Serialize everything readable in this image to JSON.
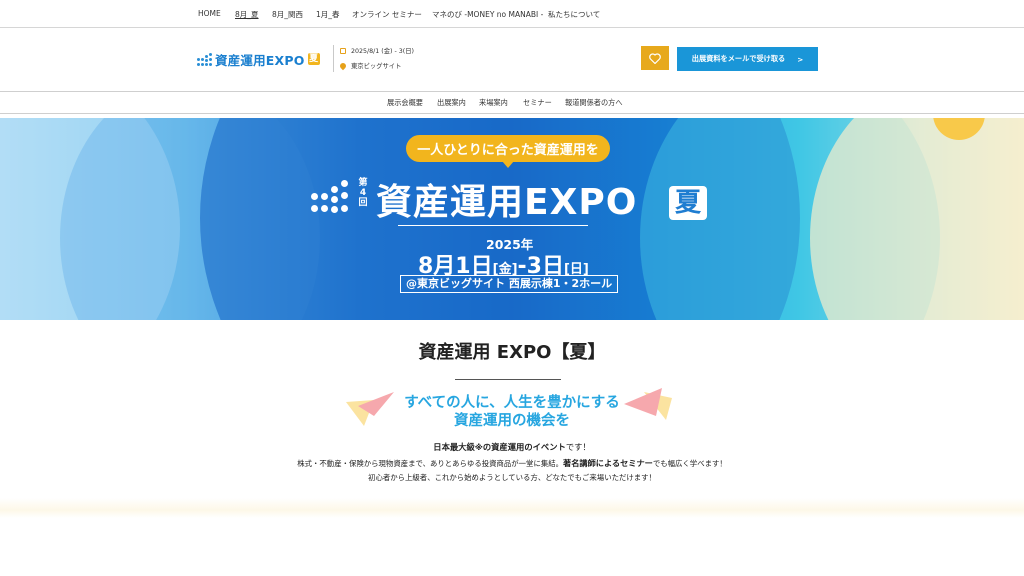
{
  "top_nav": [
    "HOME",
    "8月_夏",
    "8月_関西",
    "1月_春",
    "オンライン セミナー",
    "マネのび -MONEY no MANABI -",
    "私たちについて"
  ],
  "header": {
    "logo_text": "資産運用EXPO",
    "logo_badge": "夏",
    "date": "2025/8/1 (金) - 3(日)",
    "venue": "東京ビッグサイト",
    "favorite_icon": "heart-icon",
    "cta_label": "出展資料をメールで受け取る",
    "cta_arrow": ">"
  },
  "sub_nav": [
    "展示会概要",
    "出展案内",
    "来場案内",
    "セミナー",
    "報道関係者の方へ"
  ],
  "hero": {
    "pill": "一人ひとりに合った資産運用を",
    "edition": "第4回",
    "title": "資産運用EXPO",
    "badge": "夏",
    "year": "2025年",
    "date_main": "8月1日",
    "date_day1": "[金]",
    "date_sep": "-3日",
    "date_day2": "[日]",
    "venue": "@東京ビッグサイト 西展示棟1・2ホール"
  },
  "main": {
    "title": "資産運用 EXPO【夏】",
    "tagline_1": "すべての人に、人生を豊かにする",
    "tagline_2": "資産運用の機会を",
    "p1_strong": "日本最大級※の資産運用のイベント",
    "p1_rest": "です！",
    "p2_a": "株式・不動産・保険から現物資産まで、ありとあらゆる投資商品が一堂に集結。",
    "p2_strong": "著名講師によるセミナー",
    "p2_b": "でも幅広く学べます！",
    "p3": "初心者から上級者、これから始めようとしている方、どなたでもご来場いただけます！"
  },
  "colors": {
    "brand_blue": "#1a96d8",
    "accent_yellow": "#f2b51d",
    "tagline_blue": "#27a6e0"
  }
}
